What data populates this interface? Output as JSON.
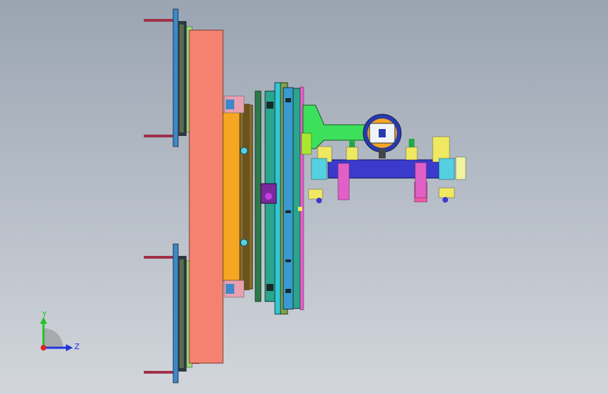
{
  "viewport": {
    "background_top": "#9aa4b2",
    "background_bottom": "#d2d6dc"
  },
  "triad": {
    "y_label": "Y",
    "z_label": "Z",
    "y_color": "#22c422",
    "z_color": "#2233dd",
    "origin_color": "#dd2222"
  },
  "colors": {
    "plate_salmon": "#f58270",
    "plate_orange": "#f5a623",
    "bronze": "#8a6d2a",
    "teal": "#2aa58e",
    "cyan": "#33c7d6",
    "blue_bar": "#3a3acd",
    "magenta": "#e060c8",
    "yellow": "#f0e860",
    "green": "#3de05a",
    "dark": "#222222",
    "rod": "#a03048"
  }
}
